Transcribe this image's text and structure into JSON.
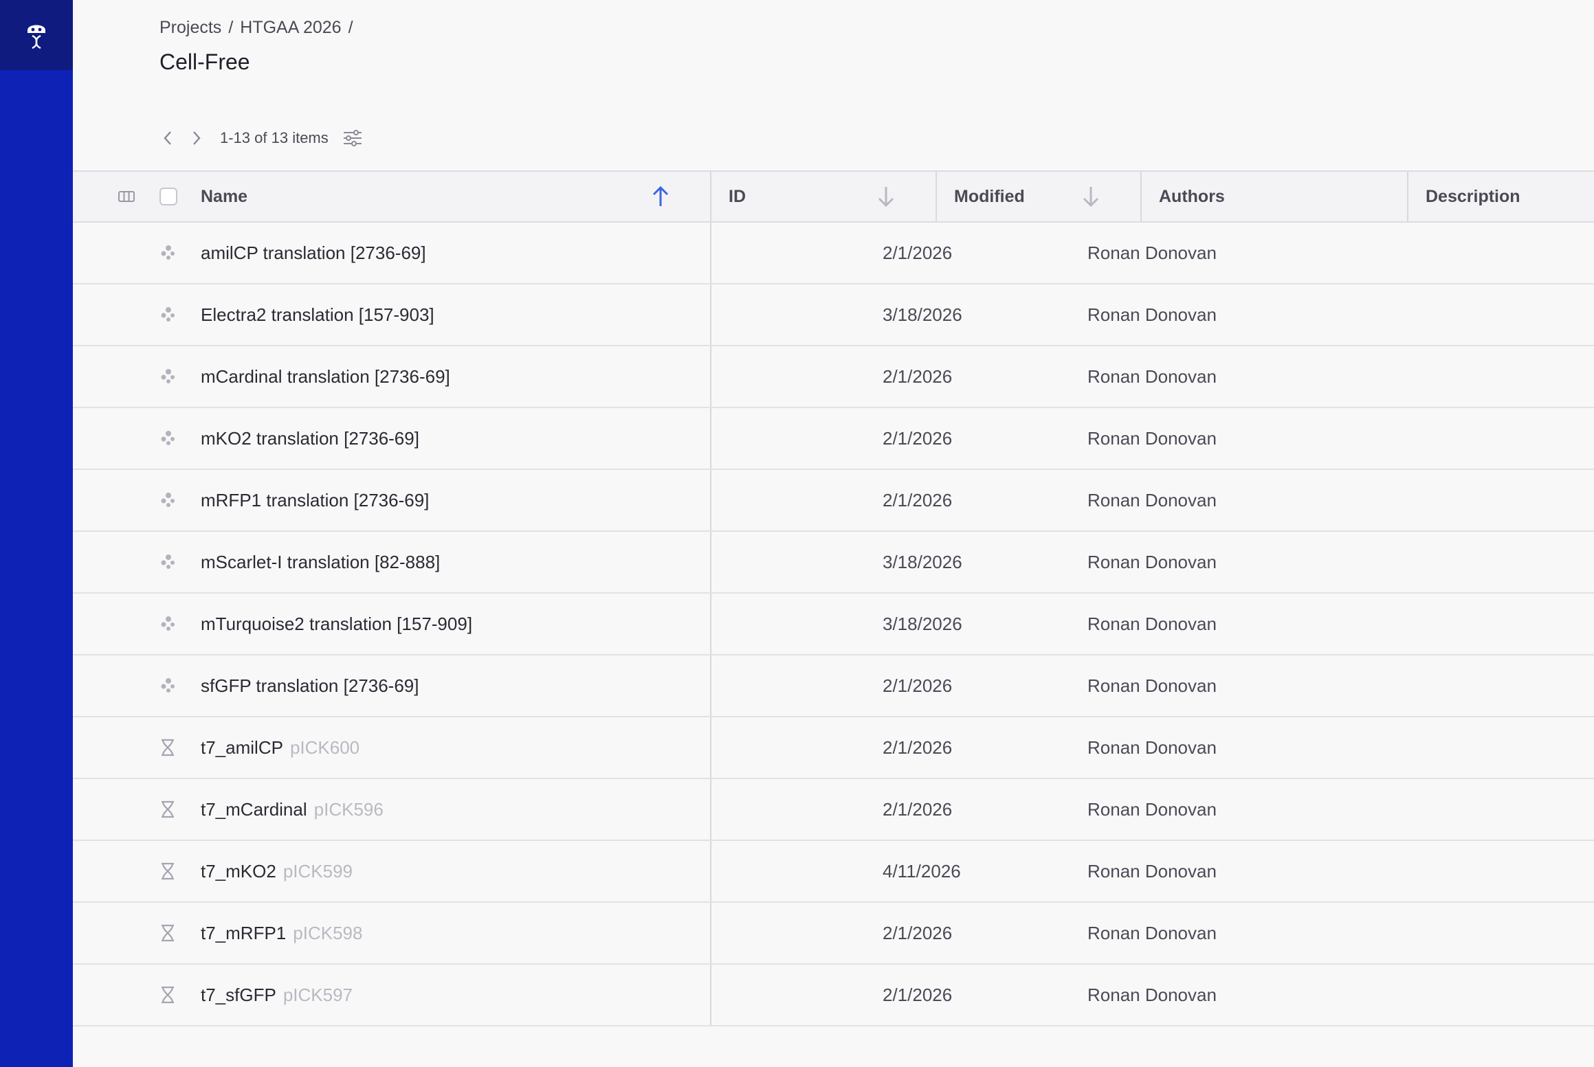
{
  "app": {
    "logo_icon": "robot-dna-logo-icon",
    "sidebar_color": "#0e22b6",
    "accent_color": "#3d63e6"
  },
  "breadcrumb": {
    "items": [
      "Projects",
      "HTGAA 2026"
    ],
    "separator": "/"
  },
  "page": {
    "title": "Cell-Free"
  },
  "pager": {
    "count_text": "1-13 of 13 items",
    "prev_icon": "chevron-left-icon",
    "next_icon": "chevron-right-icon",
    "filter_icon": "sliders-icon"
  },
  "table": {
    "columns": {
      "name": "Name",
      "id": "ID",
      "modified": "Modified",
      "authors": "Authors",
      "description": "Description"
    },
    "sort": {
      "column": "name",
      "direction": "ascending"
    },
    "rows": [
      {
        "type": "translation",
        "name": "amilCP translation [2736-69]",
        "sub": "",
        "id": "",
        "modified": "2/1/2026",
        "authors": "Ronan Donovan",
        "description": ""
      },
      {
        "type": "translation",
        "name": "Electra2 translation [157-903]",
        "sub": "",
        "id": "",
        "modified": "3/18/2026",
        "authors": "Ronan Donovan",
        "description": ""
      },
      {
        "type": "translation",
        "name": "mCardinal translation [2736-69]",
        "sub": "",
        "id": "",
        "modified": "2/1/2026",
        "authors": "Ronan Donovan",
        "description": ""
      },
      {
        "type": "translation",
        "name": "mKO2 translation [2736-69]",
        "sub": "",
        "id": "",
        "modified": "2/1/2026",
        "authors": "Ronan Donovan",
        "description": ""
      },
      {
        "type": "translation",
        "name": "mRFP1 translation [2736-69]",
        "sub": "",
        "id": "",
        "modified": "2/1/2026",
        "authors": "Ronan Donovan",
        "description": ""
      },
      {
        "type": "translation",
        "name": "mScarlet-I translation [82-888]",
        "sub": "",
        "id": "",
        "modified": "3/18/2026",
        "authors": "Ronan Donovan",
        "description": ""
      },
      {
        "type": "translation",
        "name": "mTurquoise2 translation [157-909]",
        "sub": "",
        "id": "",
        "modified": "3/18/2026",
        "authors": "Ronan Donovan",
        "description": ""
      },
      {
        "type": "translation",
        "name": "sfGFP translation [2736-69]",
        "sub": "",
        "id": "",
        "modified": "2/1/2026",
        "authors": "Ronan Donovan",
        "description": ""
      },
      {
        "type": "dna",
        "name": "t7_amilCP",
        "sub": "pICK600",
        "id": "",
        "modified": "2/1/2026",
        "authors": "Ronan Donovan",
        "description": ""
      },
      {
        "type": "dna",
        "name": "t7_mCardinal",
        "sub": "pICK596",
        "id": "",
        "modified": "2/1/2026",
        "authors": "Ronan Donovan",
        "description": ""
      },
      {
        "type": "dna",
        "name": "t7_mKO2",
        "sub": "pICK599",
        "id": "",
        "modified": "4/11/2026",
        "authors": "Ronan Donovan",
        "description": ""
      },
      {
        "type": "dna",
        "name": "t7_mRFP1",
        "sub": "pICK598",
        "id": "",
        "modified": "2/1/2026",
        "authors": "Ronan Donovan",
        "description": ""
      },
      {
        "type": "dna",
        "name": "t7_sfGFP",
        "sub": "pICK597",
        "id": "",
        "modified": "2/1/2026",
        "authors": "Ronan Donovan",
        "description": ""
      }
    ]
  }
}
